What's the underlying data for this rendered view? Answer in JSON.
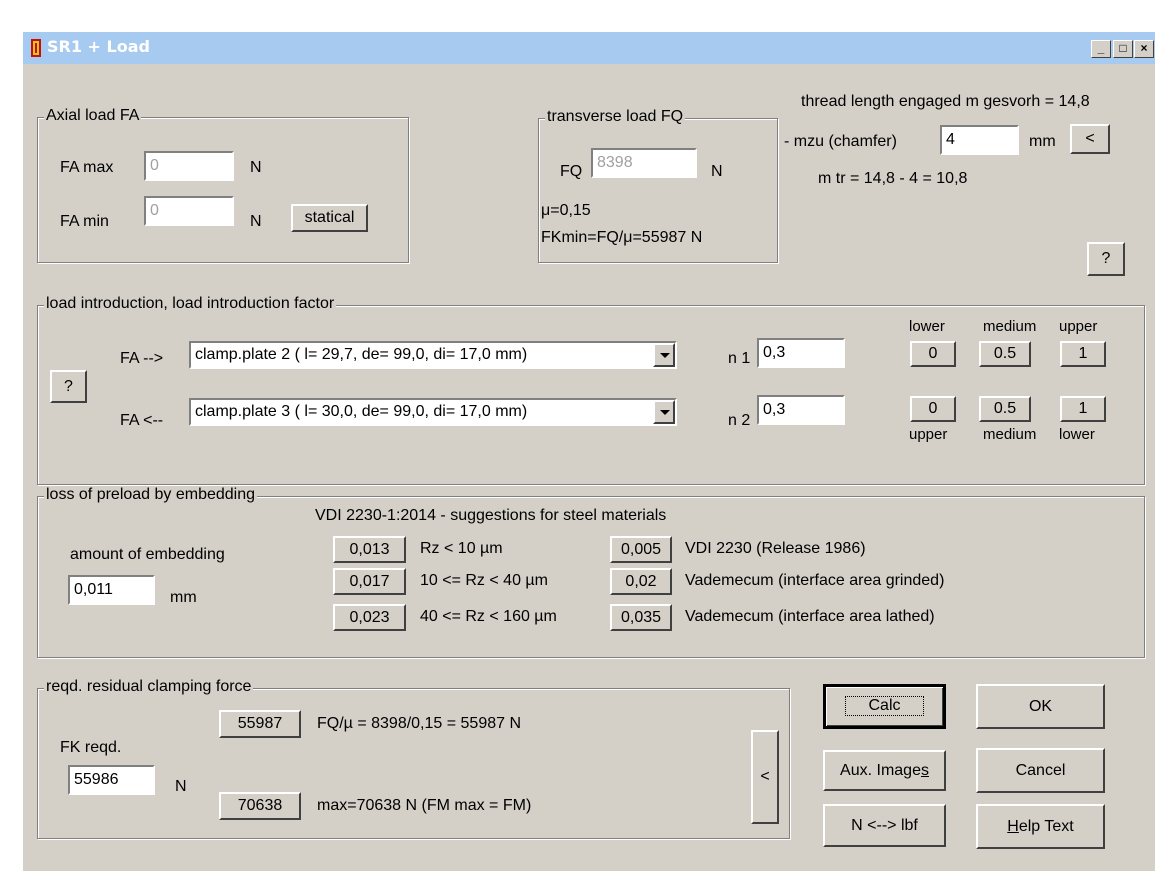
{
  "window": {
    "title": "SR1 + Load"
  },
  "axial": {
    "legend": "Axial load FA",
    "fa_max_label": "FA max",
    "fa_max_value": "0",
    "fa_max_unit": "N",
    "fa_min_label": "FA min",
    "fa_min_value": "0",
    "fa_min_unit": "N",
    "statical_label": "statical"
  },
  "transverse": {
    "legend": "transverse load FQ",
    "fq_label": "FQ",
    "fq_value": "8398",
    "fq_unit": "N",
    "mu_text": "μ=0,15",
    "fkmin_text": "FKmin=FQ/μ=55987 N"
  },
  "thread": {
    "line1": "thread length engaged m gesvorh = 14,8",
    "mzu_label": "- mzu (chamfer)",
    "mzu_value": "4",
    "mzu_unit": "mm",
    "back_label": "<",
    "mtr_text": "m tr = 14,8 - 4 = 10,8",
    "help_label": "?"
  },
  "load_intro": {
    "legend": "load introduction, load introduction factor",
    "help_label": "?",
    "fa_fwd_label": "FA  -->",
    "fa_fwd_value": "clamp.plate 2  ( l= 29,7, de= 99,0, di= 17,0 mm)",
    "n1_label": "n 1",
    "n1_value": "0,3",
    "fa_back_label": "FA  <--",
    "fa_back_value": "clamp.plate 3  ( l= 30,0, de= 99,0, di= 17,0 mm)",
    "n2_label": "n 2",
    "n2_value": "0,3",
    "top_lower": "lower",
    "top_medium": "medium",
    "top_upper": "upper",
    "row1_btns": [
      "0",
      "0.5",
      "1"
    ],
    "row2_btns": [
      "0",
      "0.5",
      "1"
    ],
    "bot_upper": "upper",
    "bot_medium": "medium",
    "bot_lower": "lower"
  },
  "embedding": {
    "legend": "loss of preload by embedding",
    "vdi_header": "VDI 2230-1:2014 - suggestions for steel materials",
    "amount_label": "amount of embedding",
    "amount_value": "0,011",
    "amount_unit": "mm",
    "left_rows": [
      {
        "btn": "0,013",
        "text": "Rz < 10 µm"
      },
      {
        "btn": "0,017",
        "text": "10 <= Rz < 40 µm"
      },
      {
        "btn": "0,023",
        "text": "40 <= Rz < 160 µm"
      }
    ],
    "right_rows": [
      {
        "btn": "0,005",
        "text": "VDI 2230 (Release 1986)"
      },
      {
        "btn": "0,02",
        "text": "Vademecum (interface area grinded)"
      },
      {
        "btn": "0,035",
        "text": "Vademecum (interface area lathed)"
      }
    ]
  },
  "residual": {
    "legend": "reqd. residual clamping force",
    "fk_label": "FK reqd.",
    "fk_value": "55986",
    "fk_unit": "N",
    "btn1": "55987",
    "text1": "FQ/µ = 8398/0,15 = 55987 N",
    "btn2": "70638",
    "text2": "max=70638 N  (FM max = FM)",
    "back_label": "<"
  },
  "buttons": {
    "calc": "Calc",
    "ok": "OK",
    "aux_pre": "Aux. Image",
    "aux_u": "s",
    "cancel": "Cancel",
    "units": "N <--> lbf",
    "help_u": "H",
    "help_post": "elp Text"
  }
}
